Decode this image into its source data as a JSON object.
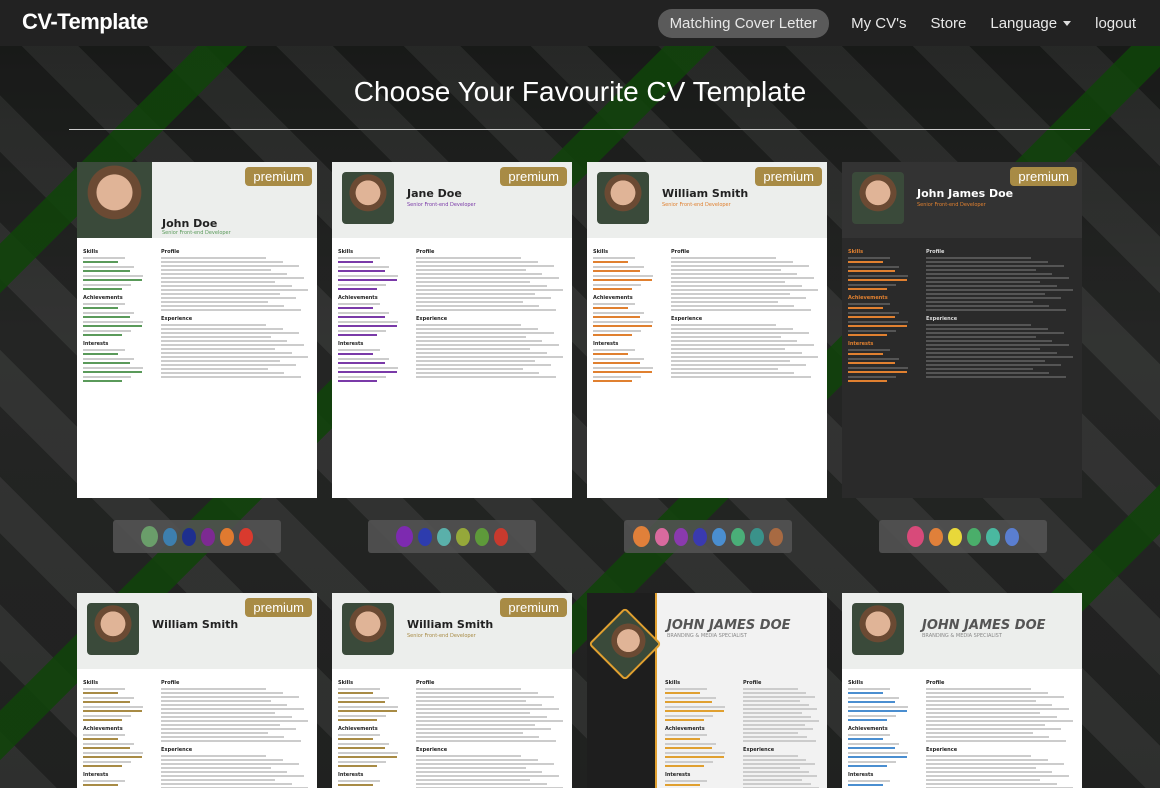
{
  "nav": {
    "logo": "CV-Template",
    "items": [
      {
        "label": "Matching Cover Letter"
      },
      {
        "label": "My CV's"
      },
      {
        "label": "Store"
      },
      {
        "label": "Language"
      },
      {
        "label": "logout"
      }
    ]
  },
  "page_title": "Choose Your Favourite CV Template",
  "badge": "premium",
  "templates": [
    {
      "name": "John Doe",
      "title": "Senior Front-end Developer",
      "premium": true,
      "accent": "#5a9a5a",
      "dark": false,
      "colors": [
        "#6a9e6a",
        "#3d7fae",
        "#1e2f8e",
        "#7d2a92",
        "#e07a30",
        "#d93a2e"
      ]
    },
    {
      "name": "Jane Doe",
      "title": "Senior Front-end Developer",
      "premium": true,
      "accent": "#7a3aa8",
      "dark": false,
      "colors": [
        "#7d2ab0",
        "#2d3cae",
        "#5ab0aa",
        "#95a83a",
        "#5e9a3a",
        "#c83a2e"
      ]
    },
    {
      "name": "William Smith",
      "title": "Senior Front-end Developer",
      "premium": true,
      "accent": "#e08030",
      "dark": false,
      "colors": [
        "#e0803a",
        "#d86a9e",
        "#8a3aae",
        "#3a3ab0",
        "#4a8ed0",
        "#4aae78",
        "#3a928a",
        "#a86a42"
      ]
    },
    {
      "name": "John James Doe",
      "title": "Senior Front-end Developer",
      "premium": true,
      "accent": "#e08030",
      "dark": true,
      "colors": [
        "#d84a7a",
        "#e0803a",
        "#e8d83a",
        "#4aae6a",
        "#4ab8a0",
        "#5a7ed0"
      ]
    },
    {
      "name": "William Smith",
      "title": "",
      "premium": true,
      "accent": "#a88b45",
      "dark": false
    },
    {
      "name": "William Smith",
      "title": "Senior Front-end Developer",
      "premium": true,
      "accent": "#a88b45",
      "dark": false
    },
    {
      "name": "JOHN JAMES DOE",
      "title": "BRANDING & MEDIA SPECIALIST",
      "premium": false,
      "accent": "#e0a030",
      "dark": true
    },
    {
      "name": "JOHN JAMES DOE",
      "title": "BRANDING & MEDIA SPECIALIST",
      "premium": false,
      "accent": "#4a8ed0",
      "dark": false
    }
  ],
  "sections": {
    "skills": "Skills",
    "profile": "Profile",
    "experience": "Experience",
    "achievements": "Achievements",
    "interests": "Interests"
  }
}
